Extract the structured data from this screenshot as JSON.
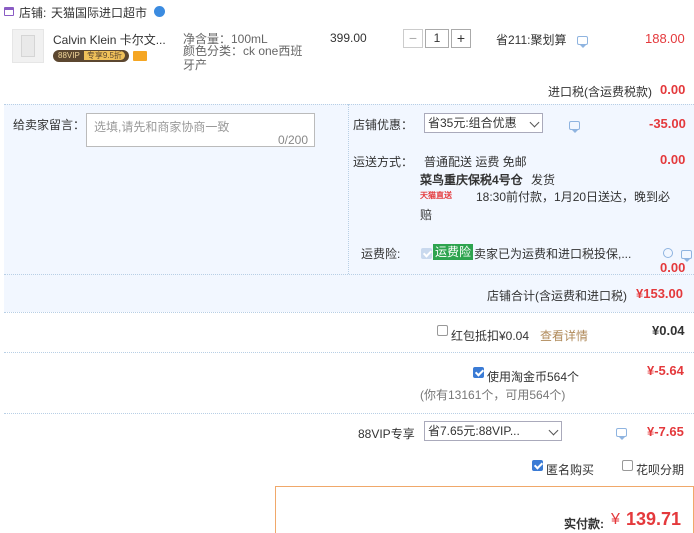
{
  "store": {
    "label": "店铺:",
    "name": "天猫国际进口超市"
  },
  "product": {
    "title": "Calvin Klein 卡尔文...",
    "vip_badge": "88VIP",
    "vip_discount": "专享9.5折",
    "spec_volume": "净含量：100mL",
    "spec_color": "颜色分类：ck one西班牙产",
    "price": "399.00",
    "quantity": "1",
    "promo": "省211:聚划算",
    "subtotal": "188.00"
  },
  "import_tax": {
    "label": "进口税(含运费税款)",
    "value": "0.00"
  },
  "message": {
    "label": "给卖家留言：",
    "placeholder": "选填,请先和商家协商一致",
    "counter": "0/200"
  },
  "store_discount": {
    "label": "店铺优惠：",
    "selected": "省35元:组合优惠",
    "value": "-35.00"
  },
  "shipping": {
    "label": "运送方式：",
    "method": "普通配送 运费 免邮",
    "value": "0.00",
    "warehouse": "菜鸟重庆保税4号仓",
    "ship_note": "发货",
    "express_badge": "天猫直送",
    "delivery": "18:30前付款，1月20日送达，晚到必赔"
  },
  "freight_insurance": {
    "label": "运费险:",
    "badge": "运费险",
    "text": "卖家已为运费和进口税投保,...",
    "value": "0.00"
  },
  "store_total": {
    "label": "店铺合计(含运费和进口税)",
    "value": "¥153.00"
  },
  "red_packet": {
    "label": "红包抵扣¥0.04",
    "link": "查看详情",
    "value": "¥0.04",
    "checked": false
  },
  "taobao_coins": {
    "label": "使用淘金币564个",
    "sub": "(你有13161个，可用564个)",
    "value": "¥-5.64",
    "checked": true
  },
  "vip88": {
    "label": "88VIP专享",
    "selected": "省7.65元:88VIP...",
    "value": "¥-7.65"
  },
  "anonymous": {
    "label": "匿名购买",
    "checked": true
  },
  "huabei": {
    "label": "花呗分期",
    "checked": false
  },
  "payment": {
    "label": "实付款:",
    "currency": "¥",
    "amount": "139.71"
  },
  "colors": {
    "price_red": "#e4393c",
    "panel_blue": "#f2f7ff",
    "accent_blue": "#3a7bd5"
  }
}
